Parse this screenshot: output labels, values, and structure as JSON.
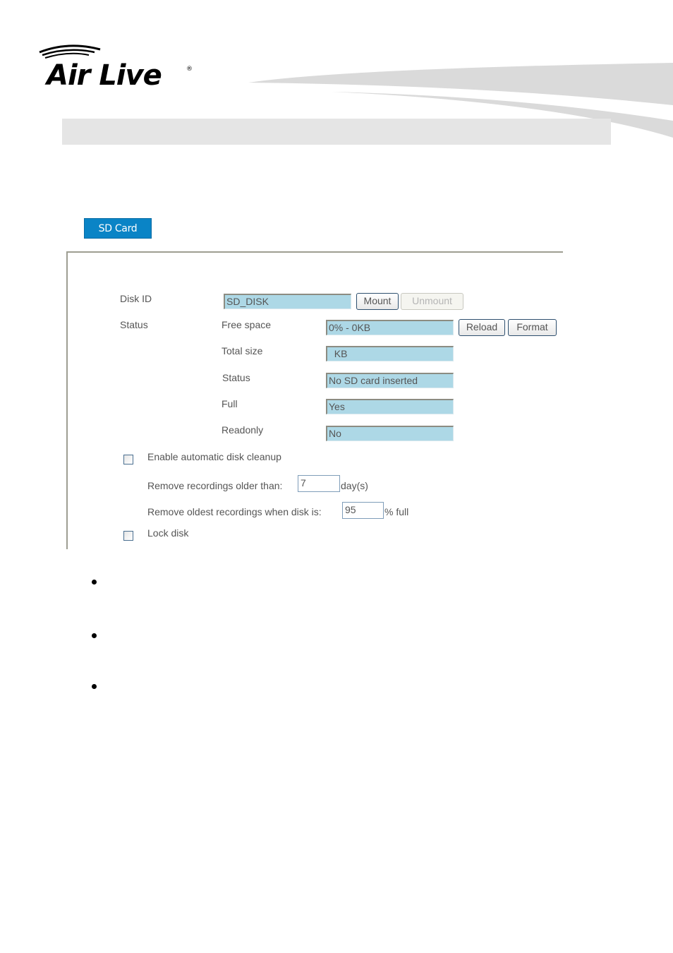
{
  "brand": {
    "logo_text": "Air Live",
    "logo_mark": "®",
    "logo_icon": "wifi-arcs-icon"
  },
  "tabs": [
    {
      "label": "SD Card",
      "active": true
    }
  ],
  "sd_card": {
    "disk_id": {
      "label": "Disk ID",
      "value": "SD_DISK"
    },
    "buttons": {
      "mount": "Mount",
      "unmount": "Unmount",
      "reload": "Reload",
      "format": "Format"
    },
    "status_label": "Status",
    "status_fields": [
      {
        "label": "Free space",
        "value": "0% - 0KB"
      },
      {
        "label": "Total size",
        "value": "  KB"
      },
      {
        "label": "Status",
        "value": "No SD card inserted"
      },
      {
        "label": "Full",
        "value": "Yes"
      },
      {
        "label": "Readonly",
        "value": "No"
      }
    ],
    "cleanup": {
      "enable_label": "Enable automatic disk cleanup",
      "enable_checked": false,
      "older_than_label": "Remove recordings older than:",
      "older_than_value": "7",
      "older_than_unit": "day(s)",
      "disk_full_label": "Remove oldest recordings when disk is:",
      "disk_full_value": "95",
      "disk_full_unit": "% full"
    },
    "lock_disk": {
      "label": "Lock disk",
      "checked": false
    }
  },
  "bullets": [
    "",
    "",
    ""
  ],
  "colors": {
    "tab_accent": "#0a84c6",
    "field_bg": "#add8e6",
    "header_bar": "#e5e5e5"
  }
}
